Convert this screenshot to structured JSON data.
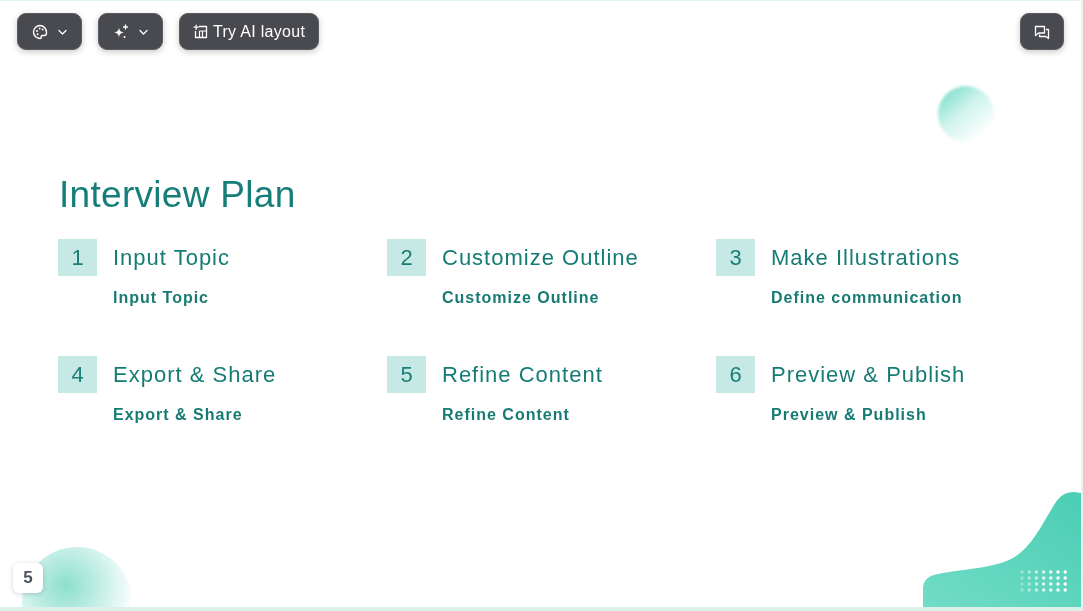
{
  "toolbar": {
    "left": [
      {
        "kind": "palette",
        "dropdown": true
      },
      {
        "kind": "sparkle",
        "dropdown": true
      },
      {
        "kind": "layout",
        "dropdown": false,
        "label": "Try AI layout"
      }
    ],
    "right": [
      {
        "kind": "comments",
        "dropdown": false
      }
    ]
  },
  "slide": {
    "title": "Interview Plan",
    "steps": [
      {
        "number": "1",
        "heading": "Input Topic",
        "text": "Input Topic"
      },
      {
        "number": "2",
        "heading": "Customize Outline",
        "text": "Customize Outline"
      },
      {
        "number": "3",
        "heading": "Make Illustrations",
        "text": "Define communication"
      },
      {
        "number": "4",
        "heading": "Export & Share",
        "text": "Export & Share"
      },
      {
        "number": "5",
        "heading": "Refine Content",
        "text": "Refine Content"
      },
      {
        "number": "6",
        "heading": "Preview & Publish",
        "text": "Preview & Publish"
      }
    ],
    "page_number": "5"
  }
}
